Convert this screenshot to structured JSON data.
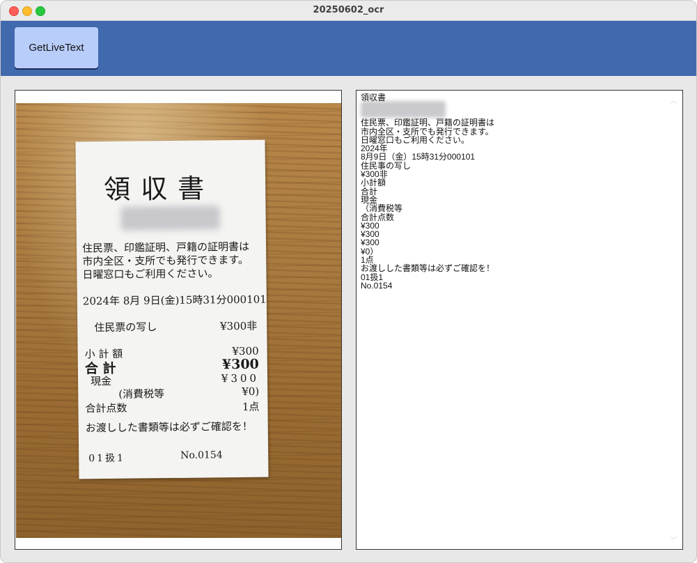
{
  "window": {
    "title": "20250602_ocr"
  },
  "toolbar": {
    "button_label": "GetLiveText"
  },
  "receipt": {
    "title": "領収書",
    "notice": "住民票、印鑑証明、戸籍の証明書は\n市内全区・支所でも発行できます。\n日曜窓口もご利用ください。",
    "datetime": "2024年 8月 9日(金)15時31分000101",
    "item": "住民票の写し",
    "item_amount": "¥300非",
    "subtotal_label": "小 計 額",
    "subtotal_value": "¥300",
    "total_label": "合 計",
    "total_value": "¥300",
    "cash_label": "現金",
    "cash_value": "¥300",
    "tax_label": "(消費税等",
    "tax_value": "¥0)",
    "count_label": "合計点数",
    "count_value": "1点",
    "footer": "お渡しした書類等は必ずご確認を！",
    "code": "01扱1",
    "number": "No.0154"
  },
  "ocr_lines": [
    "領収書",
    "",
    "住民票、印鑑証明、戸籍の証明書は",
    "市内全区・支所でも発行できます。",
    "日曜窓口もご利用ください。",
    "2024年",
    "8月9日（金）15時31分000101",
    "住民事の写し",
    "¥300非",
    "小計額",
    "合計",
    "現金",
    "（消費税等",
    "合計点数",
    "¥300",
    "¥300",
    "¥300",
    "¥0）",
    "1点",
    "お渡しした書類等は必ずご確認を！",
    "01扱1",
    "No.0154"
  ]
}
